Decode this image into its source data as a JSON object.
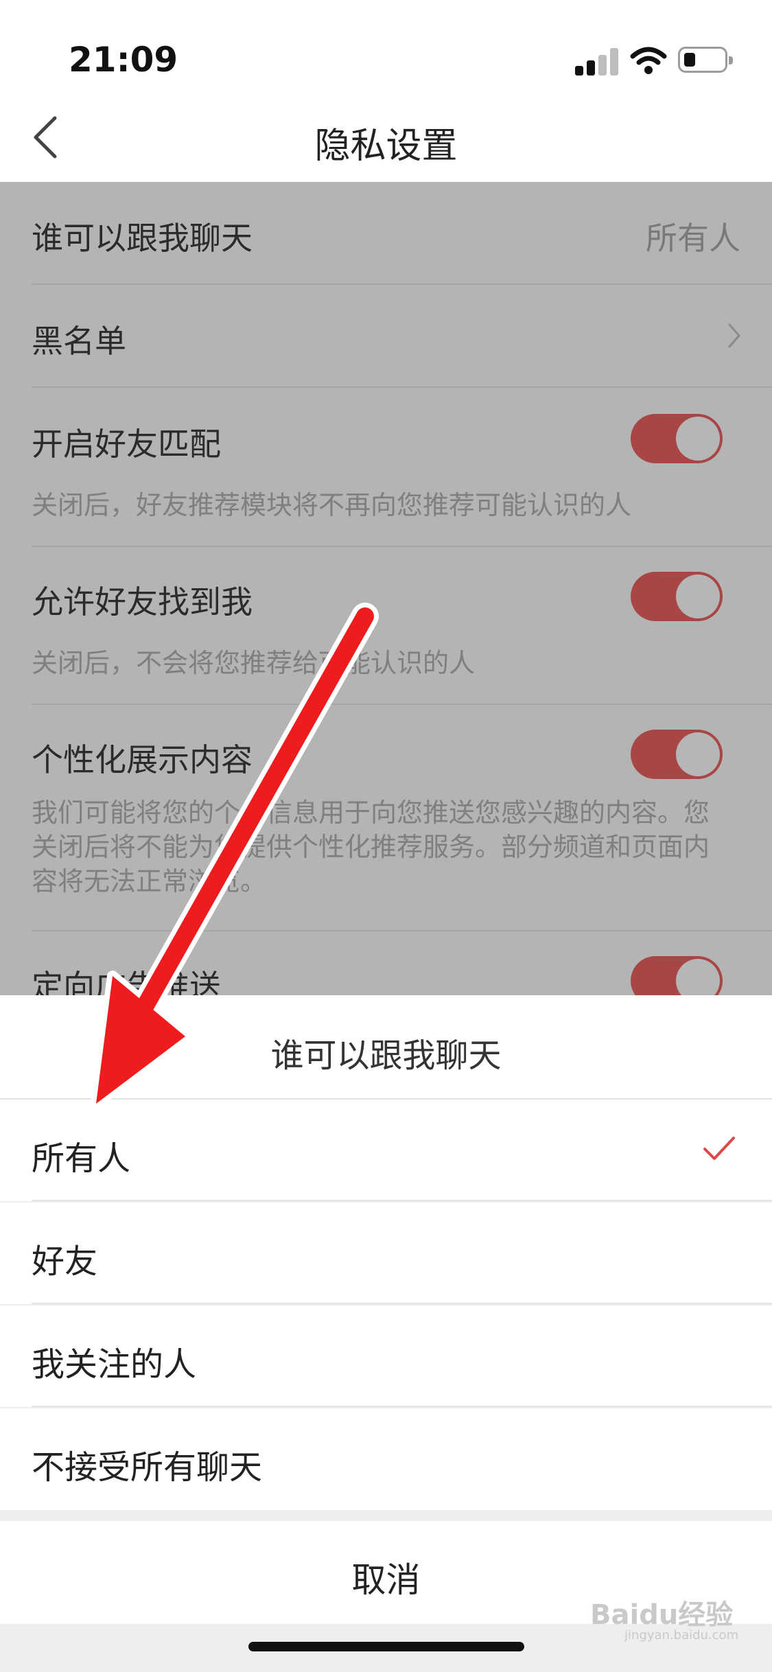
{
  "status_bar": {
    "time": "21:09"
  },
  "nav": {
    "title": "隐私设置"
  },
  "settings": {
    "chat": {
      "label": "谁可以跟我聊天",
      "value": "所有人"
    },
    "blacklist": {
      "label": "黑名单"
    },
    "friend_match": {
      "label": "开启好友匹配",
      "desc": "关闭后，好友推荐模块将不再向您推荐可能认识的人",
      "enabled": true
    },
    "find_me": {
      "label": "允许好友找到我",
      "desc": "关闭后，不会将您推荐给可能认识的人",
      "enabled": true
    },
    "personalized": {
      "label": "个性化展示内容",
      "desc": "我们可能将您的个人信息用于向您推送您感兴趣的内容。您关闭后将不能为您提供个性化推荐服务。部分频道和页面内容将无法正常浏览。",
      "enabled": true
    },
    "targeted_ads": {
      "label": "定向广告推送",
      "enabled": true
    }
  },
  "sheet": {
    "title": "谁可以跟我聊天",
    "options": [
      {
        "label": "所有人",
        "selected": true
      },
      {
        "label": "好友",
        "selected": false
      },
      {
        "label": "我关注的人",
        "selected": false
      },
      {
        "label": "不接受所有聊天",
        "selected": false
      }
    ],
    "cancel": "取消"
  },
  "watermark": {
    "brand": "Baidu经验",
    "url": "jingyan.baidu.com"
  },
  "colors": {
    "accent": "#e04646",
    "toggle_dimmed": "#a84646",
    "arrow": "#ee1c1c"
  }
}
